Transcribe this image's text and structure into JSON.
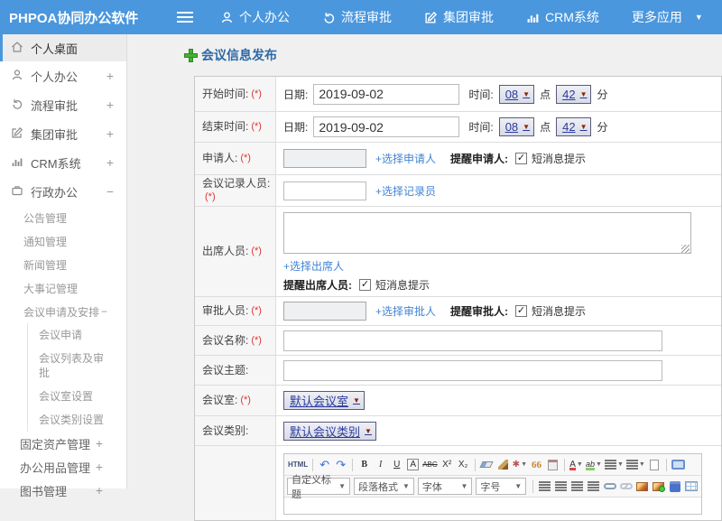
{
  "topnav": {
    "logo": "PHPOA协同办公软件",
    "items": [
      {
        "label": "个人办公"
      },
      {
        "label": "流程审批"
      },
      {
        "label": "集团审批"
      },
      {
        "label": "CRM系统"
      },
      {
        "label": "更多应用"
      }
    ]
  },
  "sidebar": {
    "items": [
      {
        "label": "个人桌面"
      },
      {
        "label": "个人办公",
        "expander": "+"
      },
      {
        "label": "流程审批",
        "expander": "+"
      },
      {
        "label": "集团审批",
        "expander": "+"
      },
      {
        "label": "CRM系统",
        "expander": "+"
      },
      {
        "label": "行政办公",
        "expander": "−"
      }
    ],
    "admin_submenu": [
      {
        "label": "公告管理"
      },
      {
        "label": "通知管理"
      },
      {
        "label": "新闻管理"
      },
      {
        "label": "大事记管理"
      }
    ],
    "meeting_group": {
      "label": "会议申请及安排",
      "expander": "−",
      "children": [
        {
          "label": "会议申请"
        },
        {
          "label": "会议列表及审批"
        },
        {
          "label": "会议室设置"
        },
        {
          "label": "会议类别设置"
        }
      ]
    },
    "bottom_items": [
      {
        "label": "固定资产管理",
        "expander": "+"
      },
      {
        "label": "办公用品管理",
        "expander": "+"
      },
      {
        "label": "图书管理",
        "expander": "+"
      }
    ]
  },
  "page": {
    "title": "会议信息发布"
  },
  "form": {
    "start_time": {
      "label": "开始时间:",
      "required": "(*)",
      "date_label": "日期:",
      "date_value": "2019-09-02",
      "time_label": "时间:",
      "hour": "08",
      "hour_unit": "点",
      "minute": "42",
      "minute_unit": "分"
    },
    "end_time": {
      "label": "结束时间:",
      "required": "(*)",
      "date_label": "日期:",
      "date_value": "2019-09-02",
      "time_label": "时间:",
      "hour": "08",
      "hour_unit": "点",
      "minute": "42",
      "minute_unit": "分"
    },
    "applicant": {
      "label": "申请人:",
      "required": "(*)",
      "link": "+选择申请人",
      "remind_label": "提醒申请人:",
      "sms_label": "短消息提示",
      "checked": "✓"
    },
    "recorder": {
      "label": "会议记录人员:",
      "required": "(*)",
      "link": "+选择记录员"
    },
    "attendees": {
      "label": "出席人员:",
      "required": "(*)",
      "link": "+选择出席人",
      "remind_label": "提醒出席人员:",
      "sms_label": "短消息提示",
      "checked": "✓"
    },
    "approver": {
      "label": "审批人员:",
      "required": "(*)",
      "link": "+选择审批人",
      "remind_label": "提醒审批人:",
      "sms_label": "短消息提示",
      "checked": "✓"
    },
    "meeting_name": {
      "label": "会议名称:",
      "required": "(*)"
    },
    "meeting_topic": {
      "label": "会议主题:"
    },
    "meeting_room": {
      "label": "会议室:",
      "required": "(*)",
      "value": "默认会议室"
    },
    "meeting_type": {
      "label": "会议类别:",
      "value": "默认会议类别"
    },
    "editor": {
      "icons": {
        "html": "HTML",
        "undo": "↶",
        "redo": "↷",
        "bold": "B",
        "italic": "I",
        "underline": "U",
        "font_border": "A",
        "strikethrough": "ABC",
        "superscript": "X²",
        "subscript": "X₂",
        "paint_format": "✱",
        "blockquote": "66",
        "font_color": "A",
        "highlight": "ab"
      },
      "selects": [
        {
          "label": "自定义标题"
        },
        {
          "label": "段落格式"
        },
        {
          "label": "字体"
        },
        {
          "label": "字号"
        }
      ]
    }
  },
  "colors": {
    "nav_blue": "#4a97dd",
    "link_blue": "#4284d4",
    "title_blue": "#2d69a5",
    "required_red": "#e03333",
    "select_text": "#2b3a9e"
  }
}
